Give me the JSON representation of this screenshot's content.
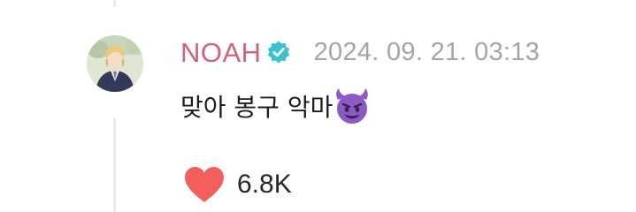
{
  "comment": {
    "author": "NOAH",
    "verified": true,
    "timestamp": "2024. 09. 21. 03:13",
    "text": "맞아 봉구 악마",
    "emoji": "smiling-devil",
    "like_count": "6.8K"
  },
  "colors": {
    "author": "#d0627a",
    "verified_badge": "#3cc2ce",
    "timestamp": "#a4a4ab",
    "heart": "#f25f5c",
    "thread_line": "#ececf0",
    "emoji": "#8b5ac4"
  },
  "icons": {
    "verified": "verified-badge-icon",
    "emoji": "smiling-devil-emoji",
    "like": "heart-icon"
  }
}
